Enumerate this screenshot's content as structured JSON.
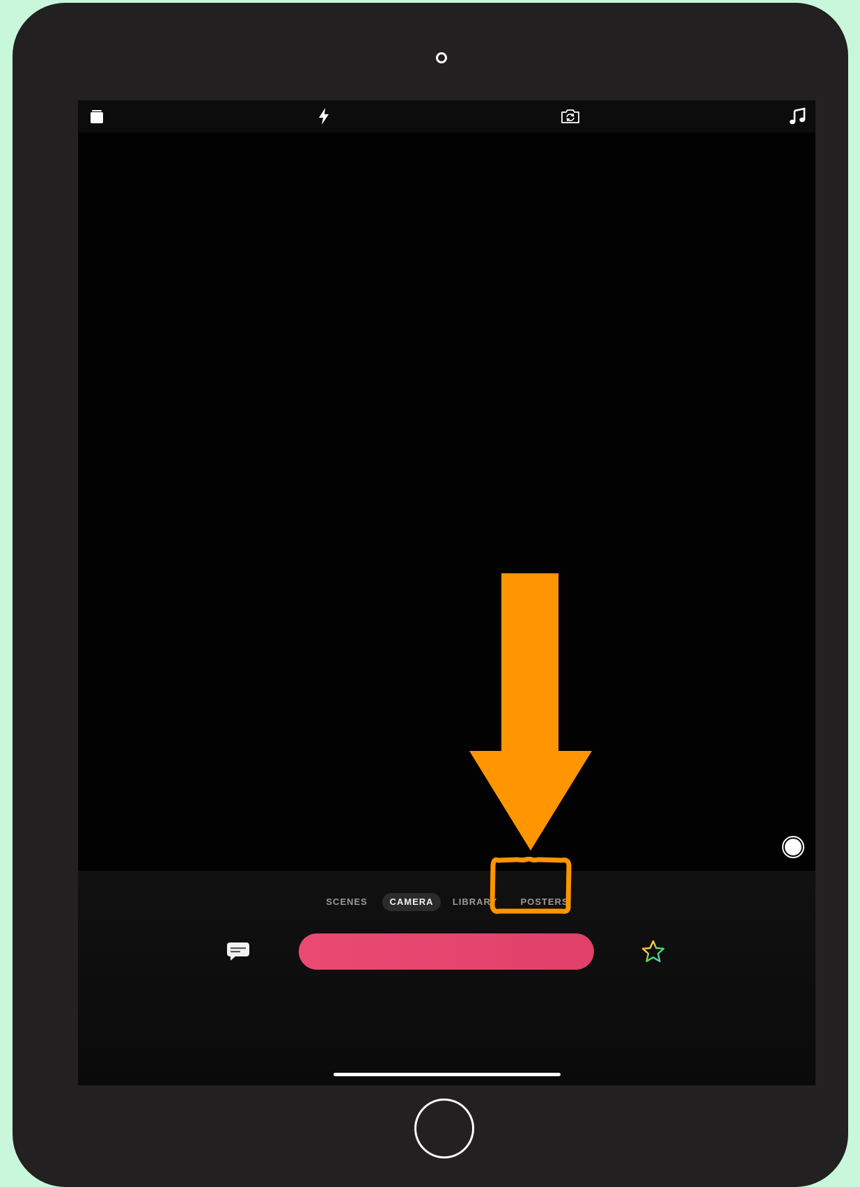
{
  "top_bar": {
    "icons": [
      "square-stack-icon",
      "flash-icon",
      "flip-camera-icon",
      "music-note-icon"
    ]
  },
  "mode_tabs": [
    {
      "label": "SCENES",
      "active": false
    },
    {
      "label": "CAMERA",
      "active": true
    },
    {
      "label": "LIBRARY",
      "active": false
    },
    {
      "label": "POSTERS",
      "active": false
    }
  ],
  "action_row": {
    "left_icon": "caption-bubble-icon",
    "right_icon": "rainbow-star-icon"
  },
  "colors": {
    "record_button": "#ea4a72",
    "annotation": "#ff9500",
    "background": "#c8f7dc",
    "device": "#222021"
  }
}
